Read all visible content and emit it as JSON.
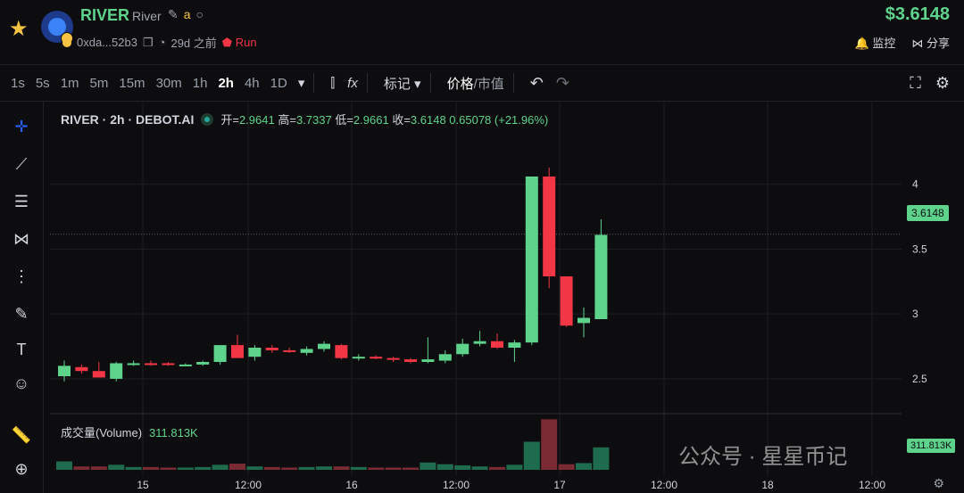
{
  "header": {
    "symbol": "RIVER",
    "name": "River",
    "address": "0xda...52b3",
    "age": "29d 之前",
    "status": "Run",
    "price": "$3.6148",
    "watch_label": "监控",
    "share_label": "分享"
  },
  "toolbar": {
    "timeframes": [
      "1s",
      "5s",
      "1m",
      "5m",
      "15m",
      "30m",
      "1h",
      "2h",
      "4h",
      "1D"
    ],
    "active": "2h",
    "mark_label": "标记",
    "price_label": "价格",
    "mcap_label": "/市值"
  },
  "legend": {
    "title": "RIVER · 2h · DEBOT.AI",
    "open_label": "开=",
    "open": "2.9641",
    "high_label": "高=",
    "high": "3.7337",
    "low_label": "低=",
    "low": "2.9661",
    "close_label": "收=",
    "close": "3.6148",
    "change": "0.65078 (+21.96%)"
  },
  "volume": {
    "label": "成交量(Volume)",
    "value": "311.813K"
  },
  "watermark": "公众号 · 星星币记",
  "colors": {
    "up": "#5ed38c",
    "down": "#f23645",
    "bg": "#0d0d0f"
  },
  "chart_data": {
    "type": "candlestick",
    "x_ticks": [
      "15",
      "12:00",
      "16",
      "12:00",
      "17",
      "12:00",
      "18",
      "12:00"
    ],
    "y_ticks": [
      "4",
      "3.5",
      "3",
      "2.5"
    ],
    "ylim": [
      2.3,
      4.5
    ],
    "last_price": "3.6148",
    "last_volume": "311.813K",
    "candles": [
      {
        "o": 2.52,
        "h": 2.64,
        "l": 2.48,
        "c": 2.6
      },
      {
        "o": 2.59,
        "h": 2.61,
        "l": 2.54,
        "c": 2.56
      },
      {
        "o": 2.56,
        "h": 2.63,
        "l": 2.52,
        "c": 2.51
      },
      {
        "o": 2.5,
        "h": 2.63,
        "l": 2.48,
        "c": 2.62
      },
      {
        "o": 2.62,
        "h": 2.64,
        "l": 2.6,
        "c": 2.62
      },
      {
        "o": 2.62,
        "h": 2.64,
        "l": 2.6,
        "c": 2.61
      },
      {
        "o": 2.62,
        "h": 2.63,
        "l": 2.6,
        "c": 2.61
      },
      {
        "o": 2.61,
        "h": 2.62,
        "l": 2.6,
        "c": 2.61
      },
      {
        "o": 2.61,
        "h": 2.64,
        "l": 2.6,
        "c": 2.63
      },
      {
        "o": 2.63,
        "h": 2.75,
        "l": 2.61,
        "c": 2.76
      },
      {
        "o": 2.76,
        "h": 2.84,
        "l": 2.66,
        "c": 2.66
      },
      {
        "o": 2.67,
        "h": 2.76,
        "l": 2.64,
        "c": 2.74
      },
      {
        "o": 2.74,
        "h": 2.76,
        "l": 2.7,
        "c": 2.72
      },
      {
        "o": 2.72,
        "h": 2.74,
        "l": 2.7,
        "c": 2.71
      },
      {
        "o": 2.7,
        "h": 2.75,
        "l": 2.68,
        "c": 2.73
      },
      {
        "o": 2.73,
        "h": 2.79,
        "l": 2.71,
        "c": 2.77
      },
      {
        "o": 2.76,
        "h": 2.77,
        "l": 2.65,
        "c": 2.66
      },
      {
        "o": 2.66,
        "h": 2.69,
        "l": 2.64,
        "c": 2.67
      },
      {
        "o": 2.67,
        "h": 2.68,
        "l": 2.65,
        "c": 2.66
      },
      {
        "o": 2.66,
        "h": 2.67,
        "l": 2.63,
        "c": 2.65
      },
      {
        "o": 2.65,
        "h": 2.66,
        "l": 2.62,
        "c": 2.63
      },
      {
        "o": 2.63,
        "h": 2.82,
        "l": 2.62,
        "c": 2.65
      },
      {
        "o": 2.64,
        "h": 2.72,
        "l": 2.62,
        "c": 2.69
      },
      {
        "o": 2.69,
        "h": 2.81,
        "l": 2.67,
        "c": 2.77
      },
      {
        "o": 2.77,
        "h": 2.87,
        "l": 2.75,
        "c": 2.79
      },
      {
        "o": 2.79,
        "h": 2.85,
        "l": 2.73,
        "c": 2.74
      },
      {
        "o": 2.74,
        "h": 2.8,
        "l": 2.63,
        "c": 2.78
      },
      {
        "o": 2.78,
        "h": 4.06,
        "l": 2.76,
        "c": 4.06
      },
      {
        "o": 4.06,
        "h": 4.13,
        "l": 3.2,
        "c": 3.29
      },
      {
        "o": 3.29,
        "h": 3.29,
        "l": 2.9,
        "c": 2.91
      },
      {
        "o": 2.93,
        "h": 3.05,
        "l": 2.82,
        "c": 2.97
      },
      {
        "o": 2.96,
        "h": 3.73,
        "l": 2.97,
        "c": 3.61
      }
    ],
    "volumes": [
      0.15,
      0.06,
      0.06,
      0.09,
      0.05,
      0.05,
      0.04,
      0.04,
      0.05,
      0.09,
      0.11,
      0.06,
      0.05,
      0.04,
      0.05,
      0.06,
      0.06,
      0.05,
      0.04,
      0.04,
      0.04,
      0.13,
      0.1,
      0.08,
      0.06,
      0.05,
      0.09,
      0.5,
      0.9,
      0.1,
      0.12,
      0.4
    ]
  }
}
